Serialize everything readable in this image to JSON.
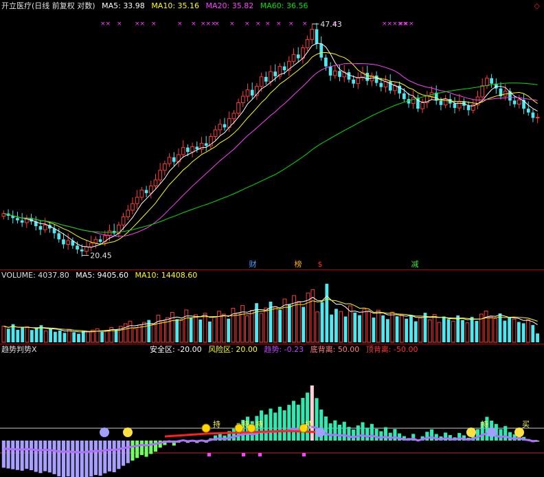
{
  "price_panel": {
    "title": "开立医疗(日线 前复权 对数)",
    "ma": [
      {
        "label": "MA5:",
        "value": "33.98",
        "color": "#ffffff"
      },
      {
        "label": "MA10:",
        "value": "35.16",
        "color": "#ffff00"
      },
      {
        "label": "MA20:",
        "value": "35.82",
        "color": "#ff40ff"
      },
      {
        "label": "MA60:",
        "value": "36.56",
        "color": "#00e000"
      }
    ],
    "high_label": "47.43",
    "low_label": "20.45",
    "corner_icon": "diamond-icon",
    "markers": [
      {
        "text": "财",
        "color": "#4aa0ff"
      },
      {
        "text": "榜",
        "color": "#ffb000"
      },
      {
        "text": "$",
        "color": "#ff3030"
      },
      {
        "text": "减",
        "color": "#40e040"
      }
    ],
    "cross_marks": [
      "××",
      "×",
      "××",
      "×",
      "×",
      "×",
      "×××",
      "×",
      "×",
      "×",
      "×",
      "×",
      "×",
      "×",
      "×",
      "×",
      "×××××",
      "×××"
    ]
  },
  "volume_panel": {
    "label": "VOLUME:",
    "value": "4037.80",
    "ma5_label": "MA5:",
    "ma5_value": "9405.60",
    "ma10_label": "MA10:",
    "ma10_value": "14408.60"
  },
  "indicator_panel": {
    "title": "趋势判势X",
    "items": [
      {
        "label": "安全区:",
        "value": "-20.00",
        "color": "#ffffff"
      },
      {
        "label": "风险区:",
        "value": "20.00",
        "color": "#ffff00"
      },
      {
        "label": "趋势:",
        "value": "-0.23",
        "color": "#c040ff"
      },
      {
        "label": "底背离:",
        "value": "50.00",
        "color": "#ff8080"
      },
      {
        "label": "顶背离:",
        "value": "-50.00",
        "color": "#ff3030"
      }
    ],
    "tags": [
      "持",
      "持",
      "持",
      "持",
      "持",
      "买"
    ]
  },
  "chart_data": [
    {
      "type": "candlestick",
      "title": "开立医疗(日线 前复权 对数)",
      "ma_lines": {
        "MA5": 33.98,
        "MA10": 35.16,
        "MA20": 35.82,
        "MA60": 36.56
      },
      "high": 47.43,
      "low": 20.45,
      "close_series": [
        23.6,
        23.4,
        23.2,
        23.0,
        22.8,
        23.2,
        22.9,
        22.5,
        22.2,
        22.6,
        22.3,
        21.9,
        21.4,
        21.0,
        21.3,
        20.9,
        20.6,
        20.45,
        20.8,
        21.1,
        21.4,
        21.2,
        21.7,
        22.1,
        21.9,
        22.6,
        23.3,
        23.9,
        24.5,
        25.1,
        25.8,
        25.5,
        26.2,
        26.8,
        27.8,
        28.5,
        29.2,
        28.7,
        29.5,
        30.3,
        29.8,
        30.4,
        30.1,
        30.8,
        30.5,
        31.6,
        32.4,
        33.1,
        32.7,
        33.8,
        34.5,
        35.9,
        36.8,
        37.7,
        36.9,
        38.2,
        39.6,
        38.9,
        40.4,
        39.7,
        41.2,
        40.6,
        42.0,
        43.1,
        42.5,
        44.2,
        45.6,
        47.43,
        44.9,
        42.6,
        41.2,
        39.8,
        40.5,
        39.6,
        40.3,
        39.2,
        38.6,
        39.5,
        40.2,
        39.0,
        39.8,
        38.7,
        38.1,
        38.9,
        37.6,
        38.3,
        37.2,
        36.4,
        35.8,
        36.6,
        35.1,
        35.9,
        36.8,
        37.3,
        36.2,
        35.6,
        36.4,
        35.8,
        35.2,
        36.1,
        35.5,
        34.9,
        35.6,
        36.7,
        38.3,
        39.4,
        38.6,
        37.9,
        36.8,
        37.5,
        36.2,
        35.7,
        36.3,
        35.1,
        34.6,
        33.9,
        33.98
      ]
    },
    {
      "type": "bar",
      "title": "VOLUME",
      "values": [
        7400,
        6200,
        8300,
        5700,
        6900,
        7100,
        5600,
        6300,
        7800,
        5200,
        6100,
        4800,
        5400,
        4300,
        5900,
        4600,
        3900,
        5100,
        4700,
        5600,
        6200,
        4800,
        5500,
        6800,
        5900,
        7300,
        8500,
        9700,
        6300,
        7900,
        9100,
        10200,
        8600,
        12400,
        9800,
        11300,
        13700,
        10600,
        9900,
        14800,
        11200,
        12600,
        10400,
        13300,
        9500,
        11700,
        14200,
        12900,
        10800,
        15600,
        13400,
        16800,
        12100,
        14600,
        17900,
        13200,
        15700,
        18600,
        16300,
        14900,
        19800,
        17200,
        21400,
        18700,
        16200,
        22600,
        24100,
        13900,
        18400,
        26800,
        12700,
        15300,
        14100,
        11800,
        16700,
        13600,
        12400,
        15100,
        13900,
        11300,
        14700,
        12300,
        10600,
        13800,
        11900,
        12600,
        10800,
        12400,
        9600,
        11200,
        13500,
        10300,
        12700,
        9100,
        11800,
        10600,
        9700,
        12300,
        10200,
        8900,
        11600,
        9800,
        12900,
        14300,
        11700,
        10800,
        13200,
        9900,
        11400,
        10600,
        9300,
        8700,
        10400,
        7900,
        4037.8
      ],
      "ma5": 9405.6,
      "ma10": 14408.6
    },
    {
      "type": "bar",
      "title": "趋势判势X",
      "safe_zone": -20.0,
      "risk_zone": 20.0,
      "trend": -0.23,
      "bottom_divergence": 50.0,
      "top_divergence": -50.0
    }
  ]
}
